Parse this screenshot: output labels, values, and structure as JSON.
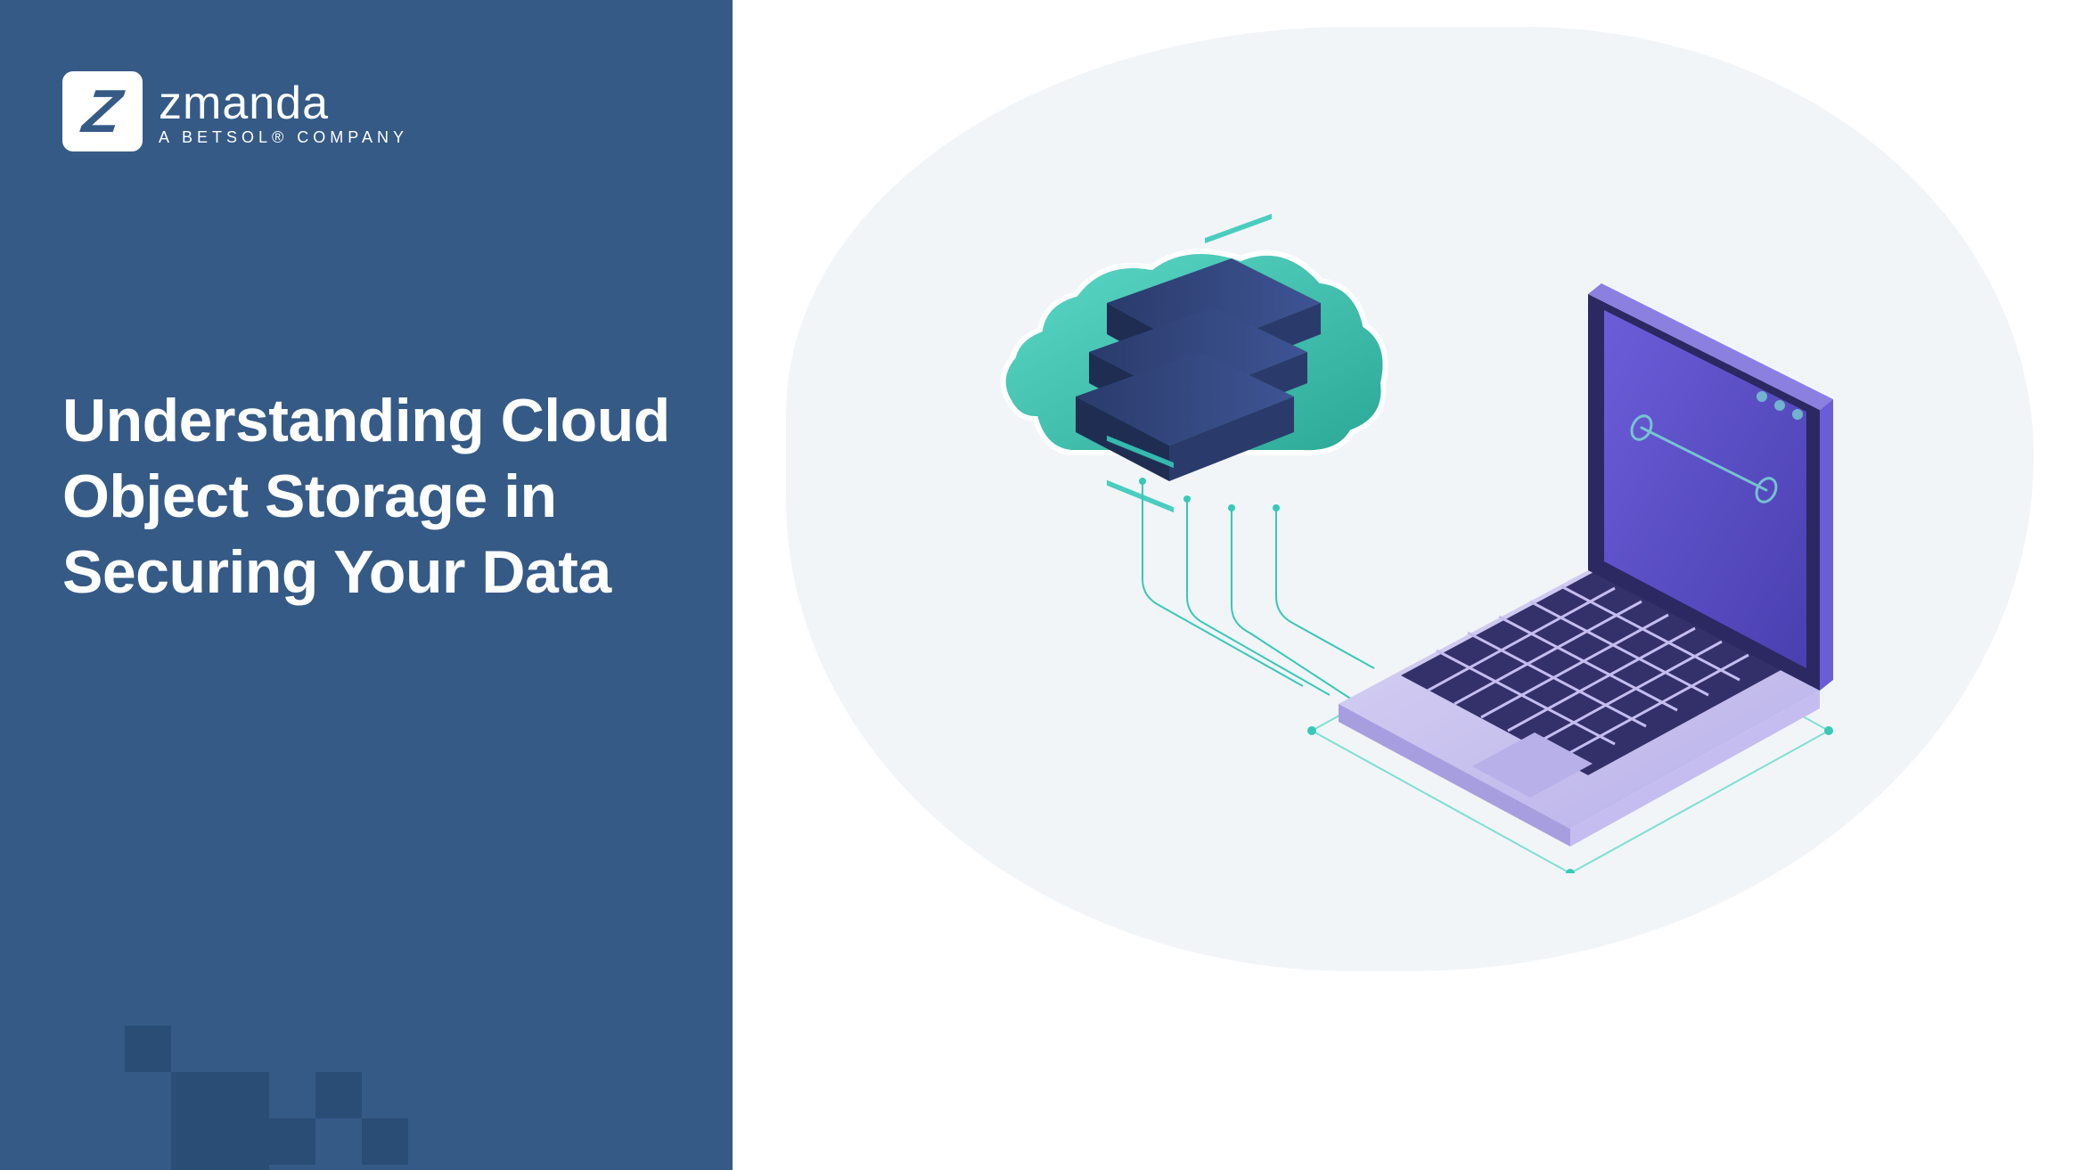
{
  "logo": {
    "name": "zmanda",
    "tagline": "A BETSOL® COMPANY"
  },
  "headline": "Understanding Cloud Object Storage in Securing Your Data",
  "colors": {
    "panel_bg": "#355a86",
    "deco_square": "#2a4d75",
    "blob_bg": "#f2f5f8",
    "cloud_teal": "#36c9b8",
    "cloud_dark": "#2a3b6b",
    "laptop_purple": "#5b4fb8",
    "laptop_keyboard": "#2b2862"
  }
}
